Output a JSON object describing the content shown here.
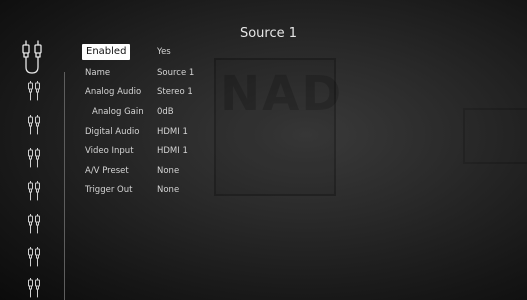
{
  "title": "Source 1",
  "watermark": "NAD",
  "sidebar": {
    "active_icon": "rca-connector-pair-icon",
    "icons": [
      "rca-connector-icon",
      "rca-connector-icon",
      "rca-connector-icon",
      "rca-connector-icon",
      "rca-connector-icon",
      "rca-connector-icon",
      "rca-connector-icon"
    ]
  },
  "settings": [
    {
      "label": "Enabled",
      "value": "Yes"
    },
    {
      "label": "Name",
      "value": "Source 1"
    },
    {
      "label": "Analog Audio",
      "value": "Stereo 1"
    },
    {
      "label": "Analog Gain",
      "value": "0dB"
    },
    {
      "label": "Digital Audio",
      "value": "HDMI 1"
    },
    {
      "label": "Video Input",
      "value": "HDMI 1"
    },
    {
      "label": "A/V Preset",
      "value": "None"
    },
    {
      "label": "Trigger Out",
      "value": "None"
    }
  ]
}
